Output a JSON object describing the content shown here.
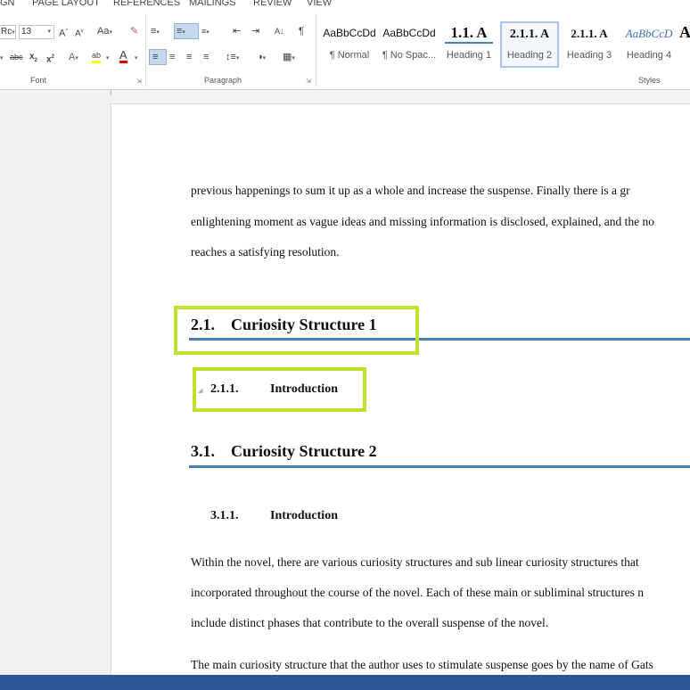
{
  "ribbon_tabs": [
    "GN",
    "PAGE LAYOUT",
    "REFERENCES",
    "MAILINGS",
    "REVIEW",
    "VIEW"
  ],
  "font": {
    "name": "Rc",
    "size": "13",
    "group_label": "Font"
  },
  "paragraph": {
    "group_label": "Paragraph"
  },
  "styles": {
    "group_label": "Styles",
    "items": [
      {
        "sample": "AaBbCcDd",
        "name": "¶ Normal"
      },
      {
        "sample": "AaBbCcDd",
        "name": "¶ No Spac..."
      },
      {
        "sample": "1.1.  A",
        "name": "Heading 1"
      },
      {
        "sample": "2.1.1.  A",
        "name": "Heading 2"
      },
      {
        "sample": "2.1.1.  A",
        "name": "Heading 3"
      },
      {
        "sample": "AaBbCcD",
        "name": "Heading 4"
      }
    ],
    "selected": "Heading 2"
  },
  "document": {
    "para1": [
      "previous happenings to sum it up as a whole and increase the suspense. Finally there is a gr",
      "enlightening moment as vague ideas and missing information is disclosed, explained, and the no",
      "reaches a satisfying resolution."
    ],
    "heading_a": {
      "num": "2.1.",
      "text": "Curiosity Structure 1"
    },
    "subheading_a": {
      "num": "2.1.1.",
      "text": "Introduction"
    },
    "heading_b": {
      "num": "3.1.",
      "text": "Curiosity Structure 2"
    },
    "subheading_b": {
      "num": "3.1.1.",
      "text": "Introduction"
    },
    "para2": [
      "Within the novel, there are various curiosity structures and sub linear curiosity structures that",
      "incorporated throughout the course of the novel. Each of these main or subliminal structures n",
      "include distinct phases that contribute to the overall suspense of the novel."
    ],
    "para3": "The main curiosity structure that the author uses to stimulate suspense goes by the name of Gats"
  },
  "colors": {
    "heading_rule": "#4a7ebb",
    "highlight": "#bde22f",
    "statusbar": "#2b579a"
  }
}
